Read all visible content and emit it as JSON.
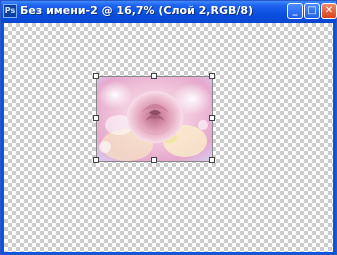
{
  "window": {
    "title": "Без имени-2 @ 16,7% (Слой 2,RGB/8)",
    "app_icon_text": "Ps",
    "controls": {
      "minimize": "_",
      "maximize": "□",
      "close": "✕"
    }
  },
  "canvas": {
    "transparency": "checkerboard",
    "layer_content": "pink-rose-image"
  },
  "colors": {
    "titlebar": "#0a55e0",
    "checker_dark": "#cccccc",
    "checker_light": "#ffffff",
    "rose_pink": "#e9a9c6",
    "rose_yellow": "#f3e6a0"
  }
}
